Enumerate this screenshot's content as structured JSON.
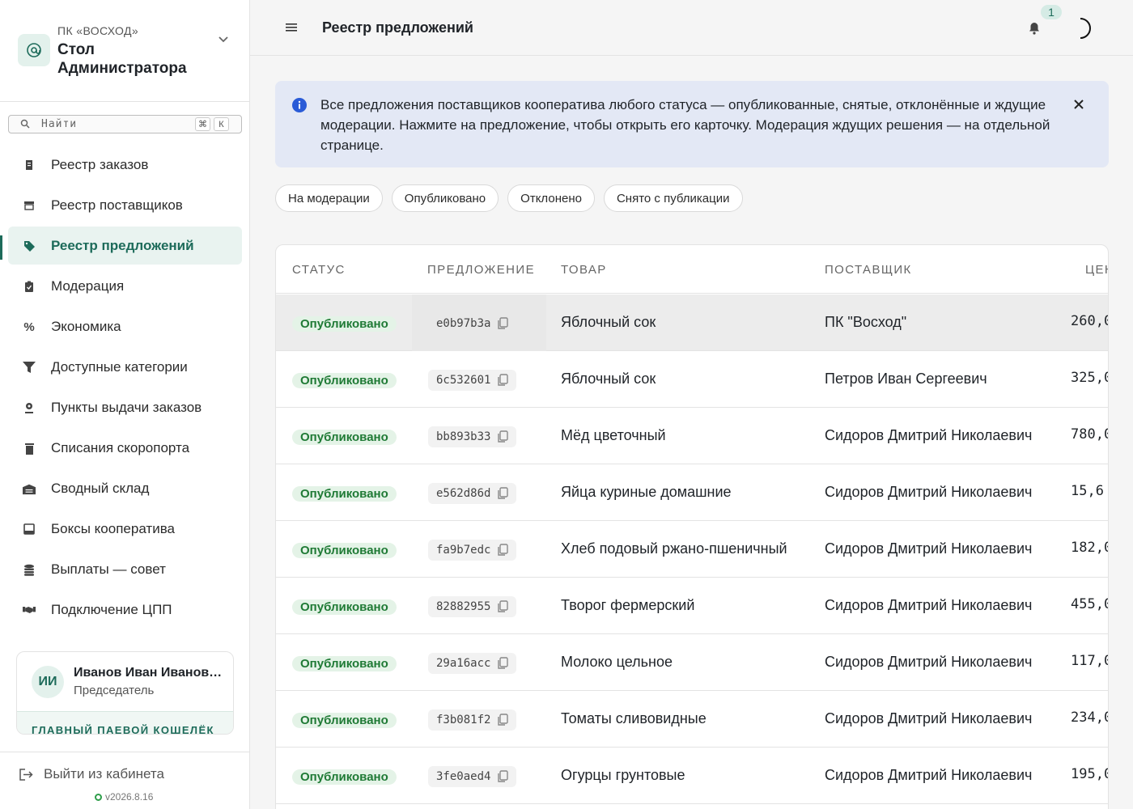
{
  "sidebar": {
    "org_subtitle": "ПК «ВОСХОД»",
    "org_title": "Стол Администратора",
    "search": {
      "placeholder": "Найти",
      "kbd1": "⌘",
      "kbd2": "К"
    },
    "items": [
      {
        "label": "Реестр заказов",
        "icon": "receipt-icon"
      },
      {
        "label": "Реестр поставщиков",
        "icon": "store-icon"
      },
      {
        "label": "Реестр предложений",
        "icon": "tag-icon",
        "active": true
      },
      {
        "label": "Модерация",
        "icon": "clipboard-check-icon"
      },
      {
        "label": "Экономика",
        "icon": "percent-icon"
      },
      {
        "label": "Доступные категории",
        "icon": "filter-icon"
      },
      {
        "label": "Пункты выдачи заказов",
        "icon": "location-pin-icon"
      },
      {
        "label": "Списания скоропорта",
        "icon": "trash-icon"
      },
      {
        "label": "Сводный склад",
        "icon": "warehouse-icon"
      },
      {
        "label": "Боксы кооператива",
        "icon": "box-icon"
      },
      {
        "label": "Выплаты — совет",
        "icon": "coins-icon"
      },
      {
        "label": "Подключение ЦПП",
        "icon": "handshake-icon"
      }
    ],
    "user": {
      "initials": "ИИ",
      "name": "Иванов Иван Иванович",
      "role": "Председатель",
      "wallet_label": "ГЛАВНЫЙ ПАЕВОЙ КОШЕЛЁК"
    },
    "logout_label": "Выйти из кабинета",
    "version": "v2026.8.16"
  },
  "header": {
    "title": "Реестр предложений",
    "notification_count": "1"
  },
  "banner": {
    "text": "Все предложения поставщиков кооператива любого статуса — опубликованные, снятые, отклонённые и ждущие модерации. Нажмите на предложение, чтобы открыть его карточку. Модерация ждущих решения — на отдельной странице."
  },
  "filters": [
    "На модерации",
    "Опубликовано",
    "Отклонено",
    "Снято с публикации"
  ],
  "table": {
    "columns": {
      "status": "СТАТУС",
      "offer": "ПРЕДЛОЖЕНИЕ",
      "product": "ТОВАР",
      "supplier": "ПОСТАВЩИК",
      "price": "ЦЕН"
    },
    "rows": [
      {
        "status": "Опубликовано",
        "offer": "e0b97b3a",
        "product": "Яблочный сок",
        "supplier": "ПК \"Восход\"",
        "price": "260,0"
      },
      {
        "status": "Опубликовано",
        "offer": "6c532601",
        "product": "Яблочный сок",
        "supplier": "Петров Иван Сергеевич",
        "price": "325,0"
      },
      {
        "status": "Опубликовано",
        "offer": "bb893b33",
        "product": "Мёд цветочный",
        "supplier": "Сидоров Дмитрий Николаевич",
        "price": "780,0"
      },
      {
        "status": "Опубликовано",
        "offer": "e562d86d",
        "product": "Яйца куриные домашние",
        "supplier": "Сидоров Дмитрий Николаевич",
        "price": "15,6"
      },
      {
        "status": "Опубликовано",
        "offer": "fa9b7edc",
        "product": "Хлеб подовый ржано-пшеничный",
        "supplier": "Сидоров Дмитрий Николаевич",
        "price": "182,0"
      },
      {
        "status": "Опубликовано",
        "offer": "82882955",
        "product": "Творог фермерский",
        "supplier": "Сидоров Дмитрий Николаевич",
        "price": "455,0"
      },
      {
        "status": "Опубликовано",
        "offer": "29a16acc",
        "product": "Молоко цельное",
        "supplier": "Сидоров Дмитрий Николаевич",
        "price": "117,0"
      },
      {
        "status": "Опубликовано",
        "offer": "f3b081f2",
        "product": "Томаты сливовидные",
        "supplier": "Сидоров Дмитрий Николаевич",
        "price": "234,0"
      },
      {
        "status": "Опубликовано",
        "offer": "3fe0aed4",
        "product": "Огурцы грунтовые",
        "supplier": "Сидоров Дмитрий Николаевич",
        "price": "195,0"
      }
    ]
  },
  "colors": {
    "accent": "#1d6b5a",
    "status_green": "#1f7a35",
    "banner_bg": "#e3e8f5"
  }
}
